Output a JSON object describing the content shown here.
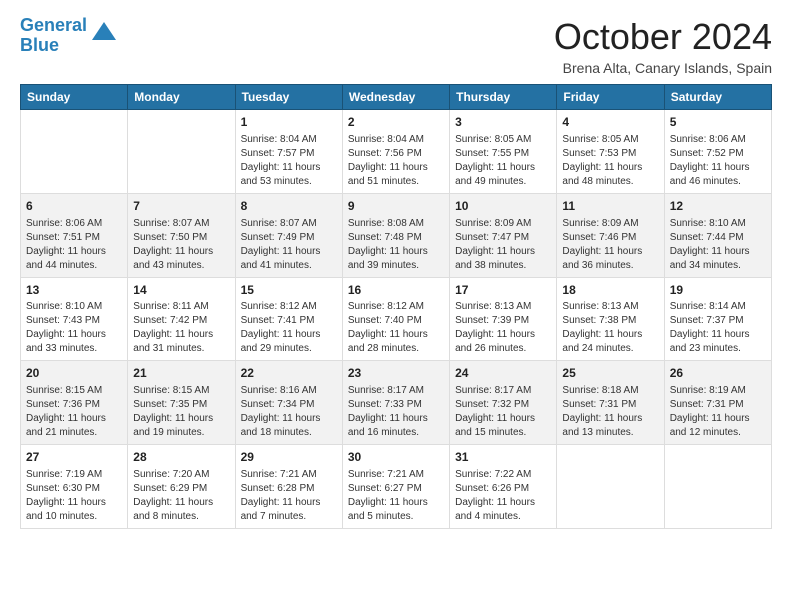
{
  "header": {
    "logo_line1": "General",
    "logo_line2": "Blue",
    "month": "October 2024",
    "location": "Brena Alta, Canary Islands, Spain"
  },
  "weekdays": [
    "Sunday",
    "Monday",
    "Tuesday",
    "Wednesday",
    "Thursday",
    "Friday",
    "Saturday"
  ],
  "weeks": [
    [
      {
        "day": "",
        "info": ""
      },
      {
        "day": "",
        "info": ""
      },
      {
        "day": "1",
        "info": "Sunrise: 8:04 AM\nSunset: 7:57 PM\nDaylight: 11 hours and 53 minutes."
      },
      {
        "day": "2",
        "info": "Sunrise: 8:04 AM\nSunset: 7:56 PM\nDaylight: 11 hours and 51 minutes."
      },
      {
        "day": "3",
        "info": "Sunrise: 8:05 AM\nSunset: 7:55 PM\nDaylight: 11 hours and 49 minutes."
      },
      {
        "day": "4",
        "info": "Sunrise: 8:05 AM\nSunset: 7:53 PM\nDaylight: 11 hours and 48 minutes."
      },
      {
        "day": "5",
        "info": "Sunrise: 8:06 AM\nSunset: 7:52 PM\nDaylight: 11 hours and 46 minutes."
      }
    ],
    [
      {
        "day": "6",
        "info": "Sunrise: 8:06 AM\nSunset: 7:51 PM\nDaylight: 11 hours and 44 minutes."
      },
      {
        "day": "7",
        "info": "Sunrise: 8:07 AM\nSunset: 7:50 PM\nDaylight: 11 hours and 43 minutes."
      },
      {
        "day": "8",
        "info": "Sunrise: 8:07 AM\nSunset: 7:49 PM\nDaylight: 11 hours and 41 minutes."
      },
      {
        "day": "9",
        "info": "Sunrise: 8:08 AM\nSunset: 7:48 PM\nDaylight: 11 hours and 39 minutes."
      },
      {
        "day": "10",
        "info": "Sunrise: 8:09 AM\nSunset: 7:47 PM\nDaylight: 11 hours and 38 minutes."
      },
      {
        "day": "11",
        "info": "Sunrise: 8:09 AM\nSunset: 7:46 PM\nDaylight: 11 hours and 36 minutes."
      },
      {
        "day": "12",
        "info": "Sunrise: 8:10 AM\nSunset: 7:44 PM\nDaylight: 11 hours and 34 minutes."
      }
    ],
    [
      {
        "day": "13",
        "info": "Sunrise: 8:10 AM\nSunset: 7:43 PM\nDaylight: 11 hours and 33 minutes."
      },
      {
        "day": "14",
        "info": "Sunrise: 8:11 AM\nSunset: 7:42 PM\nDaylight: 11 hours and 31 minutes."
      },
      {
        "day": "15",
        "info": "Sunrise: 8:12 AM\nSunset: 7:41 PM\nDaylight: 11 hours and 29 minutes."
      },
      {
        "day": "16",
        "info": "Sunrise: 8:12 AM\nSunset: 7:40 PM\nDaylight: 11 hours and 28 minutes."
      },
      {
        "day": "17",
        "info": "Sunrise: 8:13 AM\nSunset: 7:39 PM\nDaylight: 11 hours and 26 minutes."
      },
      {
        "day": "18",
        "info": "Sunrise: 8:13 AM\nSunset: 7:38 PM\nDaylight: 11 hours and 24 minutes."
      },
      {
        "day": "19",
        "info": "Sunrise: 8:14 AM\nSunset: 7:37 PM\nDaylight: 11 hours and 23 minutes."
      }
    ],
    [
      {
        "day": "20",
        "info": "Sunrise: 8:15 AM\nSunset: 7:36 PM\nDaylight: 11 hours and 21 minutes."
      },
      {
        "day": "21",
        "info": "Sunrise: 8:15 AM\nSunset: 7:35 PM\nDaylight: 11 hours and 19 minutes."
      },
      {
        "day": "22",
        "info": "Sunrise: 8:16 AM\nSunset: 7:34 PM\nDaylight: 11 hours and 18 minutes."
      },
      {
        "day": "23",
        "info": "Sunrise: 8:17 AM\nSunset: 7:33 PM\nDaylight: 11 hours and 16 minutes."
      },
      {
        "day": "24",
        "info": "Sunrise: 8:17 AM\nSunset: 7:32 PM\nDaylight: 11 hours and 15 minutes."
      },
      {
        "day": "25",
        "info": "Sunrise: 8:18 AM\nSunset: 7:31 PM\nDaylight: 11 hours and 13 minutes."
      },
      {
        "day": "26",
        "info": "Sunrise: 8:19 AM\nSunset: 7:31 PM\nDaylight: 11 hours and 12 minutes."
      }
    ],
    [
      {
        "day": "27",
        "info": "Sunrise: 7:19 AM\nSunset: 6:30 PM\nDaylight: 11 hours and 10 minutes."
      },
      {
        "day": "28",
        "info": "Sunrise: 7:20 AM\nSunset: 6:29 PM\nDaylight: 11 hours and 8 minutes."
      },
      {
        "day": "29",
        "info": "Sunrise: 7:21 AM\nSunset: 6:28 PM\nDaylight: 11 hours and 7 minutes."
      },
      {
        "day": "30",
        "info": "Sunrise: 7:21 AM\nSunset: 6:27 PM\nDaylight: 11 hours and 5 minutes."
      },
      {
        "day": "31",
        "info": "Sunrise: 7:22 AM\nSunset: 6:26 PM\nDaylight: 11 hours and 4 minutes."
      },
      {
        "day": "",
        "info": ""
      },
      {
        "day": "",
        "info": ""
      }
    ]
  ]
}
